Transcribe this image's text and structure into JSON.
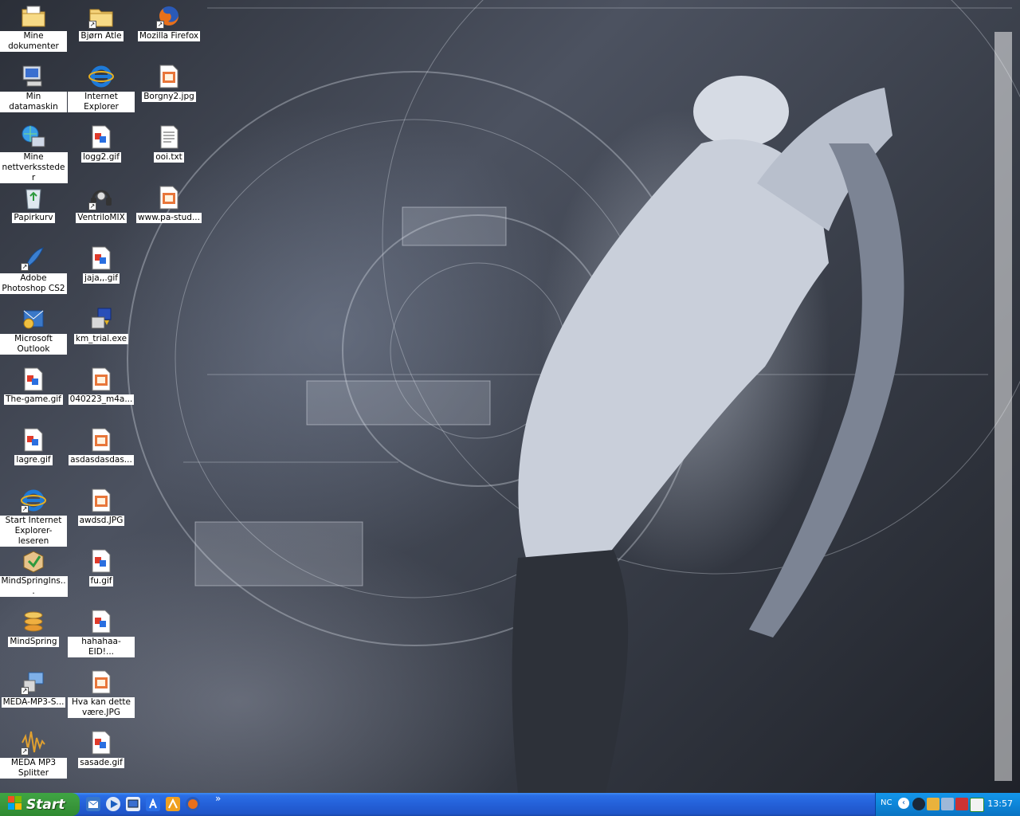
{
  "desktop": {
    "icons": [
      {
        "label": "Mine dokumenter",
        "icon": "folder-documents-icon",
        "shortcut": false
      },
      {
        "label": "Bjørn Atle",
        "icon": "folder-icon",
        "shortcut": true
      },
      {
        "label": "Mozilla Firefox",
        "icon": "firefox-icon",
        "shortcut": true
      },
      {
        "label": "Min datamaskin",
        "icon": "computer-icon",
        "shortcut": false
      },
      {
        "label": "Internet Explorer",
        "icon": "internet-explorer-icon",
        "shortcut": false
      },
      {
        "label": "Borgny2.jpg",
        "icon": "jpg-image-icon",
        "shortcut": false
      },
      {
        "label": "Mine nettverkssteder",
        "icon": "network-places-icon",
        "shortcut": false
      },
      {
        "label": "logg2.gif",
        "icon": "gif-image-icon",
        "shortcut": false
      },
      {
        "label": "ooi.txt",
        "icon": "text-file-icon",
        "shortcut": false
      },
      {
        "label": "Papirkurv",
        "icon": "recycle-bin-icon",
        "shortcut": false
      },
      {
        "label": "VentriloMIX",
        "icon": "headset-icon",
        "shortcut": true
      },
      {
        "label": "www.pa-stud...",
        "icon": "jpg-image-icon",
        "shortcut": false
      },
      {
        "label": "Adobe Photoshop CS2",
        "icon": "photoshop-feather-icon",
        "shortcut": true
      },
      {
        "label": "jaja,,.gif",
        "icon": "gif-image-icon",
        "shortcut": false
      },
      {
        "label": "Microsoft Outlook",
        "icon": "outlook-icon",
        "shortcut": false
      },
      {
        "label": "km_trial.exe",
        "icon": "installer-exe-icon",
        "shortcut": false
      },
      {
        "label": "The-game.gif",
        "icon": "gif-image-icon",
        "shortcut": false
      },
      {
        "label": "040223_m4a...",
        "icon": "jpg-image-icon",
        "shortcut": false
      },
      {
        "label": "lagre.gif",
        "icon": "gif-image-icon",
        "shortcut": false
      },
      {
        "label": "asdasdasdas...",
        "icon": "jpg-image-icon",
        "shortcut": false
      },
      {
        "label": "Start Internet Explorer-leseren",
        "icon": "internet-explorer-icon",
        "shortcut": true
      },
      {
        "label": "awdsd.JPG",
        "icon": "jpg-image-icon",
        "shortcut": false
      },
      {
        "label": "MindSpringIns...",
        "icon": "installer-box-icon",
        "shortcut": false
      },
      {
        "label": "fu.gif",
        "icon": "gif-image-icon",
        "shortcut": false
      },
      {
        "label": "MindSpring",
        "icon": "mindspring-icon",
        "shortcut": false
      },
      {
        "label": "hahahaa-EID!...",
        "icon": "gif-image-icon",
        "shortcut": false
      },
      {
        "label": "MEDA-MP3-S...",
        "icon": "meda-installer-icon",
        "shortcut": true
      },
      {
        "label": "Hva kan dette være.JPG",
        "icon": "jpg-image-icon",
        "shortcut": false
      },
      {
        "label": "MEDA MP3 Splitter",
        "icon": "audio-wave-icon",
        "shortcut": true
      },
      {
        "label": "sasade.gif",
        "icon": "gif-image-icon",
        "shortcut": false
      }
    ]
  },
  "taskbar": {
    "start_label": "Start",
    "quick_launch": [
      "outlook-icon",
      "media-player-icon",
      "show-desktop-icon",
      "messenger-icon",
      "winamp-icon",
      "firefox-icon"
    ],
    "more_label": "»",
    "tray": {
      "language": "NC",
      "expand_label": "‹",
      "icons": [
        "steam-icon",
        "antivirus-icon",
        "network-icon",
        "volume-icon",
        "ventrilo-icon"
      ],
      "clock": "13:57"
    }
  }
}
